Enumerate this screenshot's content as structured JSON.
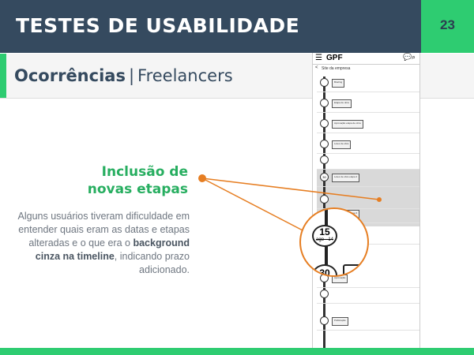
{
  "header": {
    "title": "TESTES DE USABILIDADE",
    "page_number": "23"
  },
  "subheader": {
    "title_bold": "Ocorrências",
    "separator": "|",
    "title_light": "Freelancers"
  },
  "section": {
    "heading_line1": "Inclusão de",
    "heading_line2": "novas etapas",
    "body_part1": "Alguns usuários tiveram dificuldade em entender quais eram as datas e etapas alteradas e o que era o ",
    "body_bold1": "background cinza na timeline",
    "body_part2": ", indicando prazo adicionado."
  },
  "phone": {
    "app_name": "GPF",
    "menu_icon": "☰",
    "chat_icon": "💬",
    "search_icon": "⌕",
    "back_icon": "<",
    "breadcrumb": "Site da empresa",
    "magnifier": {
      "node1_number": "15",
      "node1_date": "ago - 14",
      "node2_number": "30"
    },
    "timeline_items": [
      {
        "node": "",
        "card": "Briefing"
      },
      {
        "node": "",
        "card": "Etapa de obra"
      },
      {
        "node": "",
        "card": "Aprovação etapa de obra"
      },
      {
        "node": "",
        "card": "Lotes de obra"
      },
      {
        "node": "",
        "card": ""
      },
      {
        "node": "30",
        "card": "Lotes de obra etapa 2"
      },
      {
        "node": "",
        "card": ""
      },
      {
        "node": "",
        "card": "Lotes de obra etapa 3"
      },
      {
        "node": "",
        "card": ""
      },
      {
        "node": "",
        "card": "Aprovação"
      },
      {
        "node": "",
        "card": ""
      },
      {
        "node": "",
        "card": "Publicação"
      }
    ]
  },
  "colors": {
    "header_bg": "#354a5f",
    "accent_green": "#2ecc71",
    "heading_green": "#27ae60",
    "callout_orange": "#e67e22"
  }
}
